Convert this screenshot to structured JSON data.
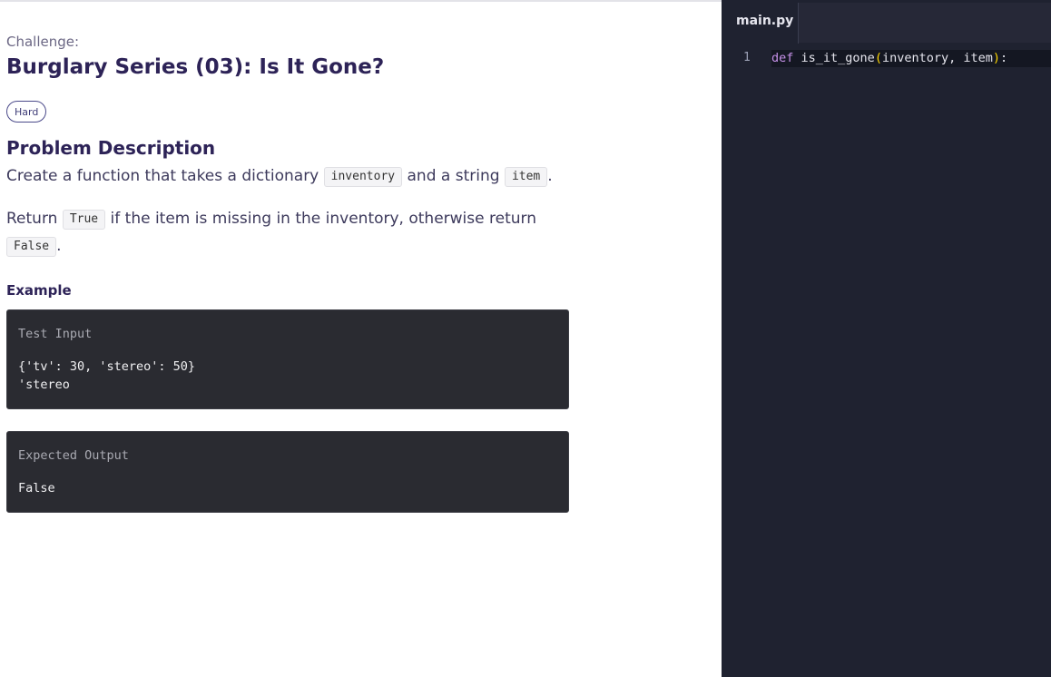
{
  "challenge": {
    "label": "Challenge:",
    "title": "Burglary Series (03): Is It Gone?",
    "difficulty": "Hard"
  },
  "description": {
    "heading": "Problem Description",
    "p1_a": "Create a function that takes a dictionary",
    "p1_code1": "inventory",
    "p1_b": "and a string",
    "p1_code2": "item",
    "p1_c": ".",
    "p2_a": "Return",
    "p2_code1": "True",
    "p2_b": "if the item is missing in the inventory, otherwise return",
    "p2_code2": "False",
    "p2_c": "."
  },
  "example": {
    "heading": "Example",
    "input_label": "Test Input",
    "input_lines": [
      "{'tv': 30, 'stereo': 50}",
      "'stereo"
    ],
    "output_label": "Expected Output",
    "output_value": "False"
  },
  "editor": {
    "tab": "main.py",
    "line_number": "1",
    "code": {
      "keyword": "def",
      "func": "is_it_gone",
      "open": "(",
      "params": "inventory, item",
      "close": ")",
      "colon": ":"
    }
  },
  "colors": {
    "title": "#2d2357",
    "editor_bg": "#1f2230",
    "box_bg": "#2a2b31",
    "keyword": "#c792ea",
    "paren": "#ffd700"
  }
}
